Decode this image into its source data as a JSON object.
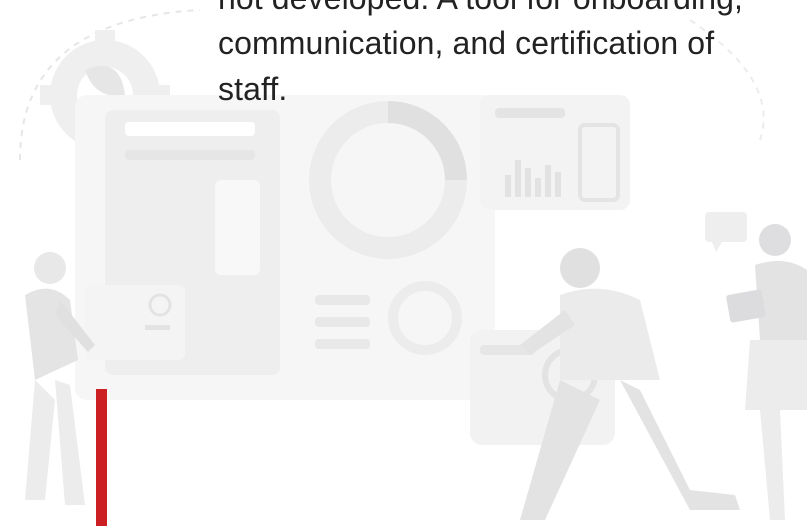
{
  "content": {
    "description_lines": [
      "not developed. A tool for onboarding,",
      "communication, and certification of",
      "staff."
    ]
  },
  "colors": {
    "accent_bar": "#cc1f24",
    "text": "#222222",
    "illustration_light": "#f1f1f2",
    "illustration_mid": "#e7e7e8",
    "illustration_dark": "#dcdcde"
  },
  "illustration": {
    "icons": [
      "gear-icon",
      "donut-chart-icon",
      "bar-chart-icon",
      "chat-bubble-icon"
    ]
  }
}
